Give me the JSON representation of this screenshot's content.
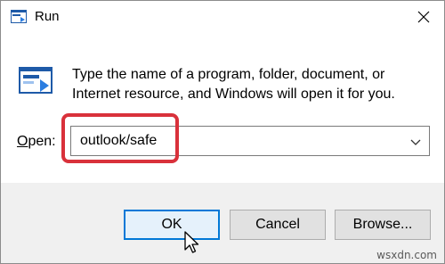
{
  "window": {
    "title": "Run"
  },
  "content": {
    "description": "Type the name of a program, folder, document, or Internet resource, and Windows will open it for you.",
    "open_label_prefix": "",
    "open_label_mnemonic": "O",
    "open_label_rest": "pen:",
    "input_value": "outlook/safe"
  },
  "buttons": {
    "ok": "OK",
    "cancel": "Cancel",
    "browse": "Browse..."
  },
  "watermark": "wsxdn.com",
  "colors": {
    "highlight": "#d9313b",
    "ok_border": "#0078d7",
    "ok_fill": "#e5f1fb"
  },
  "icons": {
    "title": "run-app-icon",
    "close": "close-icon",
    "dialog": "run-dialog-icon",
    "dropdown": "chevron-down-icon",
    "cursor": "mouse-pointer-icon"
  }
}
